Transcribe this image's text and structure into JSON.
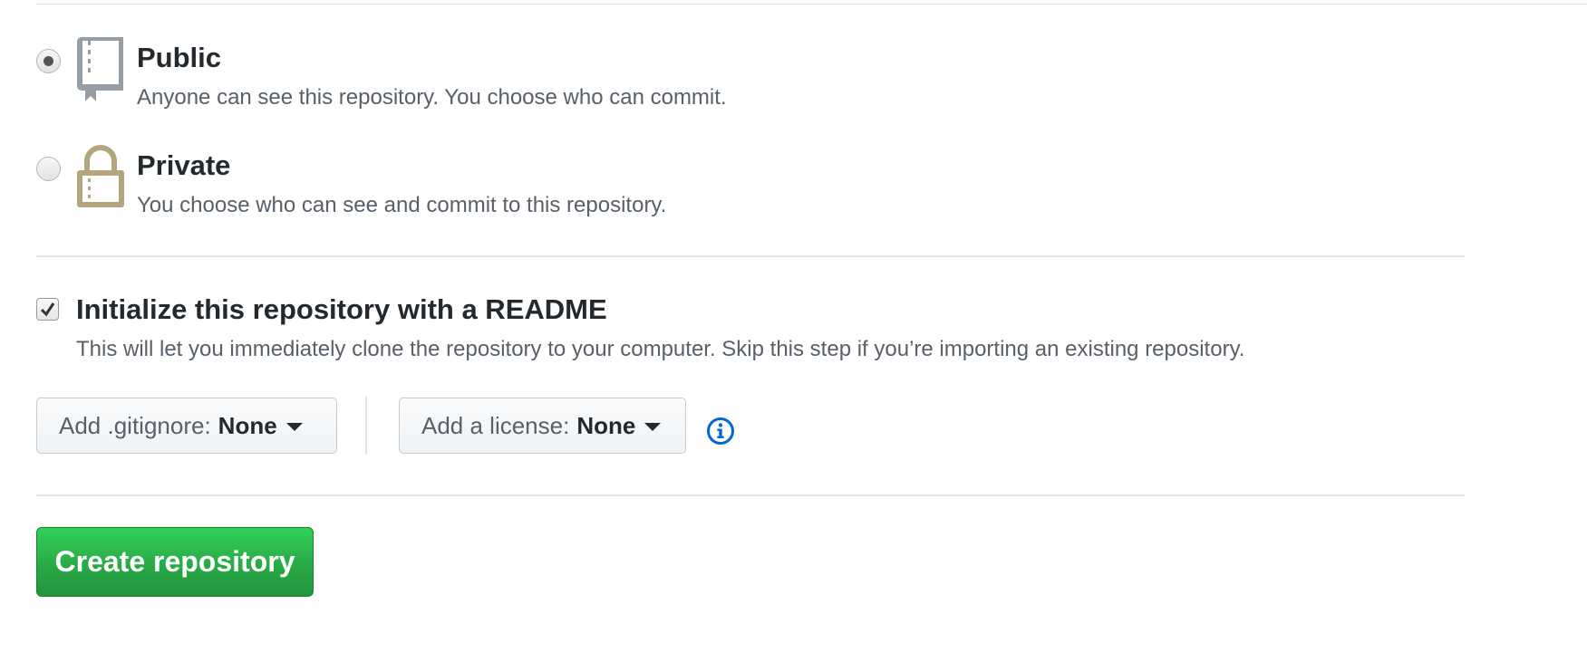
{
  "visibility": {
    "options": [
      {
        "title": "Public",
        "description": "Anyone can see this repository. You choose who can commit.",
        "icon": "repo-book-icon",
        "selected": true
      },
      {
        "title": "Private",
        "description": "You choose who can see and commit to this repository.",
        "icon": "lock-icon",
        "selected": false
      }
    ]
  },
  "readme": {
    "label": "Initialize this repository with a README",
    "description": "This will let you immediately clone the repository to your computer. Skip this step if you’re importing an existing repository.",
    "checked": true
  },
  "gitignore": {
    "label": "Add .gitignore:",
    "value": "None"
  },
  "license": {
    "label": "Add a license:",
    "value": "None"
  },
  "info_icon": "info-icon",
  "create_button": {
    "label": "Create repository"
  },
  "colors": {
    "primary_green": "#28a745",
    "info_blue": "#0366d6",
    "lock_tan": "#b5a57c",
    "book_gray": "#959da5",
    "text_primary": "#24292e",
    "text_secondary": "#586069"
  }
}
